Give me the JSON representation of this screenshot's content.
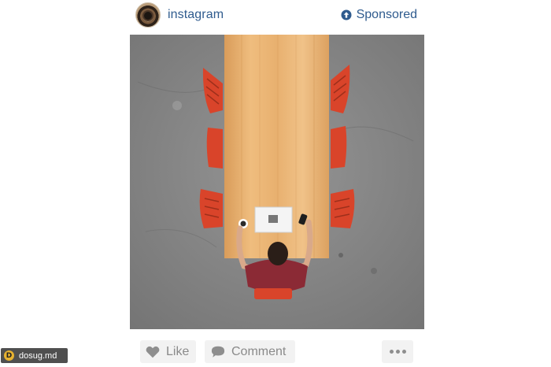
{
  "post": {
    "username": "instagram",
    "sponsored_label": "Sponsored",
    "avatar_icon": "camera-lens-avatar",
    "photo_subject": "",
    "actions": {
      "like_label": "Like",
      "comment_label": "Comment",
      "more_icon": "ellipsis-icon"
    }
  },
  "watermark": {
    "text": "dosug.md",
    "logo_letter": "D"
  },
  "colors": {
    "link_blue": "#2f5b8e",
    "button_bg": "#f2f2f2",
    "button_text": "#8a8a8a",
    "table_wood": "#e9b271",
    "chair_red": "#d9442a",
    "floor_gray": "#8a8a8a",
    "shirt_maroon": "#8b2a35"
  }
}
